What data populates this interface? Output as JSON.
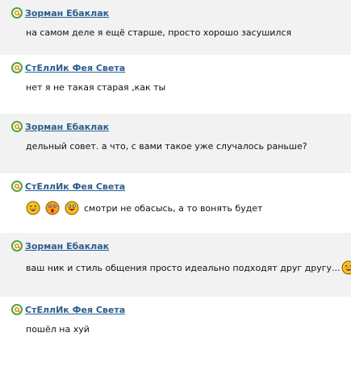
{
  "comments": [
    {
      "author": "Зорман Ебаклак",
      "text": "на самом деле я ещё старше, просто хорошо засушился"
    },
    {
      "author": "СтЕллИк Фея Света",
      "text": "нет я не такая старая ,как ты"
    },
    {
      "author": "Зорман Ебаклак",
      "text": "дельный совет. а что, с вами такое уже случалось раньше?"
    },
    {
      "author": "СтЕллИк Фея Света",
      "text": "смотри не обасысь, а то вонять будет",
      "smileys": [
        "laughing-smiley-icon",
        "surprised-smiley-icon",
        "tongue-smiley-icon"
      ]
    },
    {
      "author": "Зорман Ебаклак",
      "text": "ваш ник и стиль общения просто идеально подходят друг другу...",
      "trailing_smiley": "laughing-smiley-icon"
    },
    {
      "author": "СтЕллИк Фея Света",
      "text": "пошёл на хуй"
    }
  ],
  "colors": {
    "author_link": "#2a5d8f",
    "row_shade": "#f2f2f2",
    "smiley_face": "#f7c21c"
  }
}
